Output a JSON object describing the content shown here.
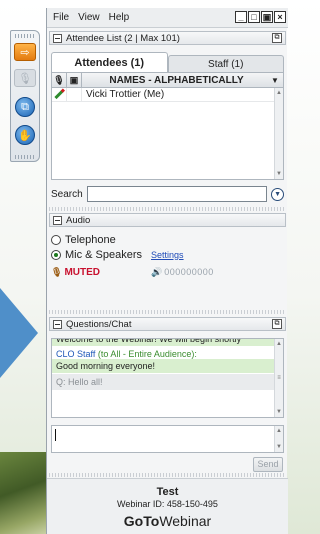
{
  "menu": [
    "File",
    "View",
    "Help"
  ],
  "window_controls": [
    "_",
    "□",
    "▣",
    "×"
  ],
  "attendee_list": {
    "header": "Attendee List  (2 | Max 101)",
    "tabs": [
      {
        "label": "Attendees (1)",
        "active": true
      },
      {
        "label": "Staff (1)",
        "active": false
      }
    ],
    "column_header": "NAMES - ALPHABETICALLY",
    "rows": [
      {
        "name": "Vicki Trottier (Me)"
      }
    ],
    "search_label": "Search",
    "search_value": ""
  },
  "audio": {
    "header": "Audio",
    "options": [
      {
        "label": "Telephone",
        "selected": false
      },
      {
        "label": "Mic & Speakers",
        "selected": true
      }
    ],
    "settings_link": "Settings",
    "status": "MUTED",
    "meter_label": "000000000"
  },
  "chat": {
    "header": "Questions/Chat",
    "messages": [
      {
        "text": "Welcome to the Webinar! We will begin shortly"
      },
      {
        "sender": "CLO Staff",
        "audience": "(to All - Entire Audience):",
        "text": "Good morning everyone!"
      }
    ],
    "pending_question": "Q: Hello all!",
    "input_value": "",
    "send_label": "Send"
  },
  "footer": {
    "title": "Test",
    "webinar_id": "Webinar ID: 458-150-495",
    "brand_bold": "GoTo",
    "brand_rest": "Webinar"
  },
  "colors": {
    "muted": "#c8102e",
    "link": "#1f4bb8",
    "chat_highlight": "#d9efcf",
    "dock_accent": "#e37b10"
  }
}
